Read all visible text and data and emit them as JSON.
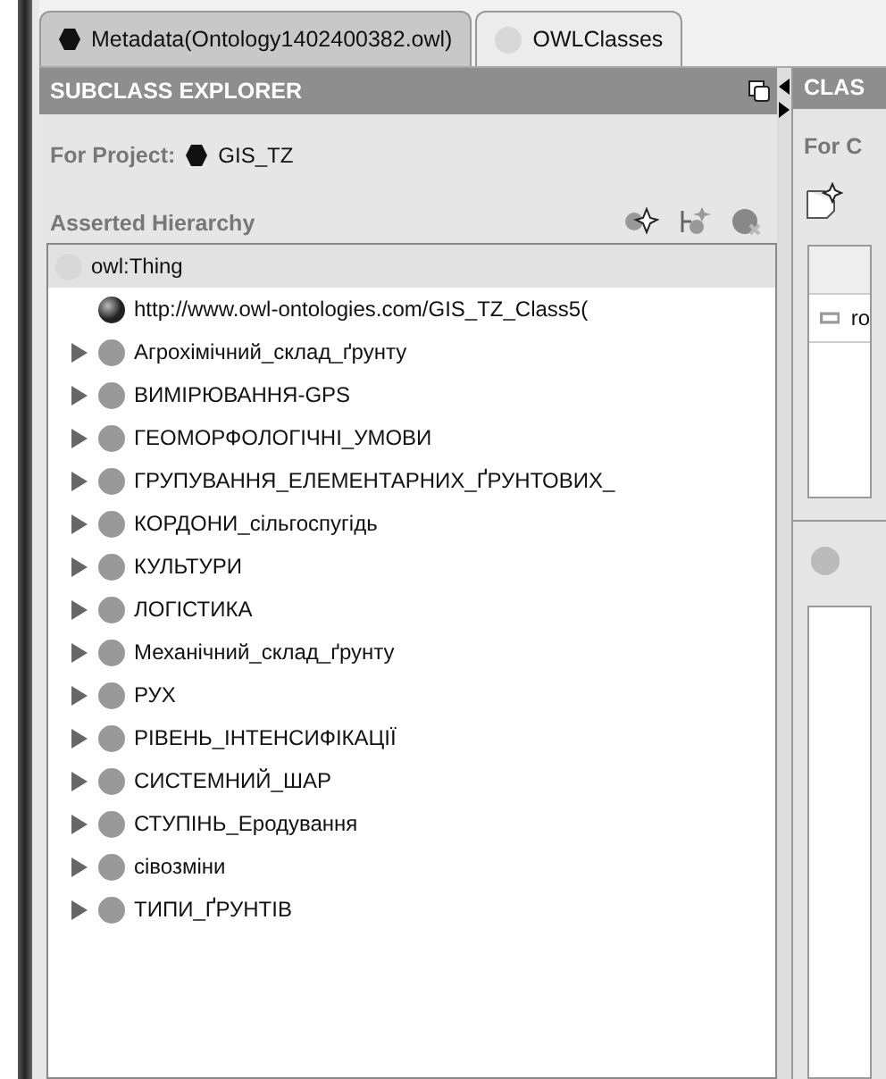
{
  "tabs": [
    {
      "label": "Metadata(Ontology1402400382.owl)",
      "kind": "ontology",
      "selected": false
    },
    {
      "label": "OWLClasses",
      "kind": "class",
      "selected": true
    }
  ],
  "left_pane": {
    "title": "SUBCLASS EXPLORER",
    "project_label": "For Project:",
    "project_name": "GIS_TZ",
    "hierarchy_label": "Asserted Hierarchy",
    "tree": [
      {
        "label": "owl:Thing",
        "kind": "root",
        "selected": true,
        "children": [
          {
            "label": "http://www.owl-ontologies.com/GIS_TZ_Class5(",
            "kind": "external",
            "selected": false
          },
          {
            "label": "Агрохімічний_склад_ґрунту",
            "kind": "class",
            "expanded": false,
            "selected": false
          },
          {
            "label": "ВИМІРЮВАННЯ-GPS",
            "kind": "class",
            "expanded": false,
            "selected": false
          },
          {
            "label": "ГЕОМОРФОЛОГІЧНІ_УМОВИ",
            "kind": "class",
            "expanded": false,
            "selected": false
          },
          {
            "label": "ГРУПУВАННЯ_ЕЛЕМЕНТАРНИХ_ҐРУНТОВИХ_",
            "kind": "class",
            "expanded": false,
            "selected": false
          },
          {
            "label": "КОРДОНИ_сільгоспугідь",
            "kind": "class",
            "expanded": false,
            "selected": false
          },
          {
            "label": "КУЛЬТУРИ",
            "kind": "class",
            "expanded": false,
            "selected": false
          },
          {
            "label": "ЛОГІСТИКА",
            "kind": "class",
            "expanded": false,
            "selected": false
          },
          {
            "label": "Механічний_склад_ґрунту",
            "kind": "class",
            "expanded": false,
            "selected": false
          },
          {
            "label": "РУХ",
            "kind": "class",
            "expanded": false,
            "selected": false
          },
          {
            "label": "РІВЕНЬ_ІНТЕНСИФІКАЦІЇ",
            "kind": "class",
            "expanded": false,
            "selected": false
          },
          {
            "label": "СИСТЕМНИЙ_ШАР",
            "kind": "class",
            "expanded": false,
            "selected": false
          },
          {
            "label": "СТУПІНЬ_Еродування",
            "kind": "class",
            "expanded": false,
            "selected": false
          },
          {
            "label": "сівозміни",
            "kind": "class",
            "expanded": false,
            "selected": false
          },
          {
            "label": "ТИПИ_ҐРУНТІВ",
            "kind": "class",
            "expanded": false,
            "selected": false
          }
        ]
      }
    ]
  },
  "right_pane": {
    "title": "CLAS",
    "for_label": "For C",
    "table_rows": [
      "ro"
    ]
  }
}
